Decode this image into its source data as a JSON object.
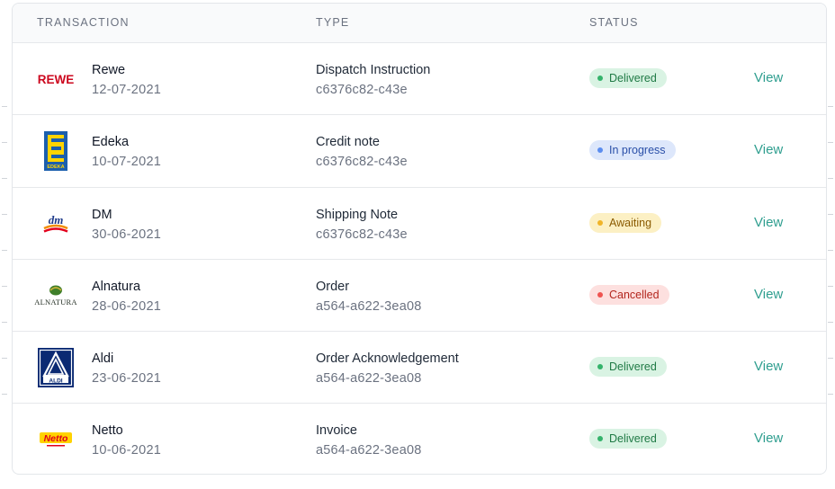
{
  "header": {
    "transaction": "TRANSACTION",
    "type": "TYPE",
    "status": "STATUS"
  },
  "rows": [
    {
      "logo": "rewe-logo",
      "logo_text": "REWE",
      "name": "Rewe",
      "date": "12-07-2021",
      "type": "Dispatch Instruction",
      "code": "c6376c82-c43e",
      "status": "Delivered",
      "action": "View"
    },
    {
      "logo": "edeka-logo",
      "logo_text": "EDEKA",
      "name": "Edeka",
      "date": "10-07-2021",
      "type": "Credit note",
      "code": "c6376c82-c43e",
      "status": "In progress",
      "action": "View"
    },
    {
      "logo": "dm-logo",
      "logo_text": "dm",
      "name": "DM",
      "date": "30-06-2021",
      "type": "Shipping Note",
      "code": "c6376c82-c43e",
      "status": "Awaiting",
      "action": "View"
    },
    {
      "logo": "alnatura-logo",
      "logo_text": "ALNATURA",
      "name": "Alnatura",
      "date": "28-06-2021",
      "type": "Order",
      "code": "a564-a622-3ea08",
      "status": "Cancelled",
      "action": "View"
    },
    {
      "logo": "aldi-logo",
      "logo_text": "ALDI",
      "name": "Aldi",
      "date": "23-06-2021",
      "type": "Order Acknowledgement",
      "code": "a564-a622-3ea08",
      "status": "Delivered",
      "action": "View"
    },
    {
      "logo": "netto-logo",
      "logo_text": "Netto",
      "name": "Netto",
      "date": "10-06-2021",
      "type": "Invoice",
      "code": "a564-a622-3ea08",
      "status": "Delivered",
      "action": "View"
    }
  ],
  "colors": {
    "action": "#2f9e8f",
    "delivered": "#34b36b",
    "in_progress": "#5b8def",
    "awaiting": "#f0b429",
    "cancelled": "#ef5350"
  }
}
